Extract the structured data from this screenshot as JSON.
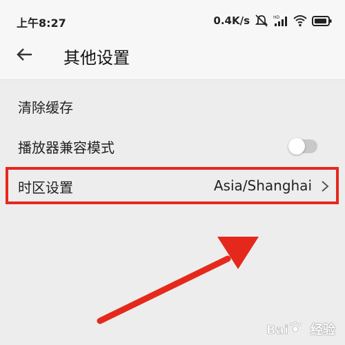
{
  "status_bar": {
    "time": "上午8:27",
    "speed": "0.4K/s",
    "icons": [
      "mute-icon",
      "signal-icon",
      "wifi-icon",
      "battery-icon"
    ]
  },
  "header": {
    "title": "其他设置",
    "back_icon": "back-arrow-icon"
  },
  "settings": {
    "clear_cache": {
      "label": "清除缓存"
    },
    "player_compat": {
      "label": "播放器兼容模式",
      "enabled": false
    },
    "timezone": {
      "label": "时区设置",
      "value": "Asia/Shanghai"
    }
  },
  "annotation": {
    "highlight_color": "#e4291c",
    "arrow_color": "#e4291c"
  },
  "watermark": {
    "text": "经验"
  }
}
